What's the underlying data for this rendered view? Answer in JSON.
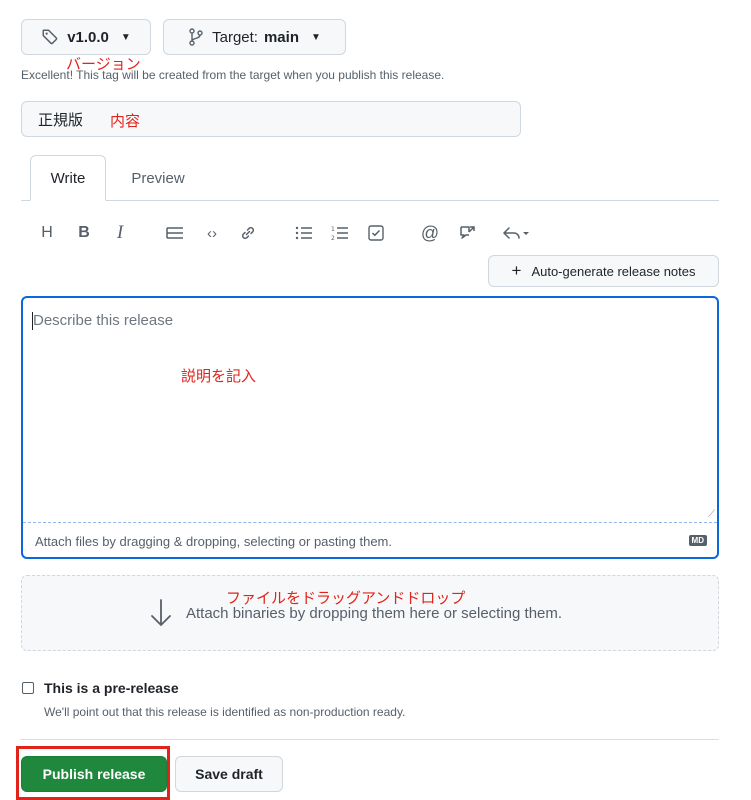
{
  "tag_button": {
    "label": "v1.0.0"
  },
  "target_button": {
    "prefix": "Target:",
    "value": "main"
  },
  "tag_hint": "Excellent! This tag will be created from the target when you publish this release.",
  "title_input": {
    "value": "正規版"
  },
  "tabs": [
    {
      "label": "Write"
    },
    {
      "label": "Preview"
    }
  ],
  "auto_generate": {
    "label": "Auto-generate release notes"
  },
  "description": {
    "placeholder": "Describe this release"
  },
  "attach_files": {
    "text": "Attach files by dragging & dropping, selecting or pasting them.",
    "badge": "MD"
  },
  "binaries": {
    "text": "Attach binaries by dropping them here or selecting them."
  },
  "prerelease": {
    "label": "This is a pre-release",
    "hint": "We'll point out that this release is identified as non-production ready."
  },
  "publish_button": {
    "label": "Publish release"
  },
  "draft_button": {
    "label": "Save draft"
  },
  "annotations": {
    "version": "バージョン",
    "content": "内容",
    "description": "説明を記入",
    "dragdrop": "ファイルをドラッグアンドドロップ"
  },
  "colors": {
    "accent": "#0969da",
    "primary": "#1f883d",
    "annotation": "#e0241b"
  }
}
